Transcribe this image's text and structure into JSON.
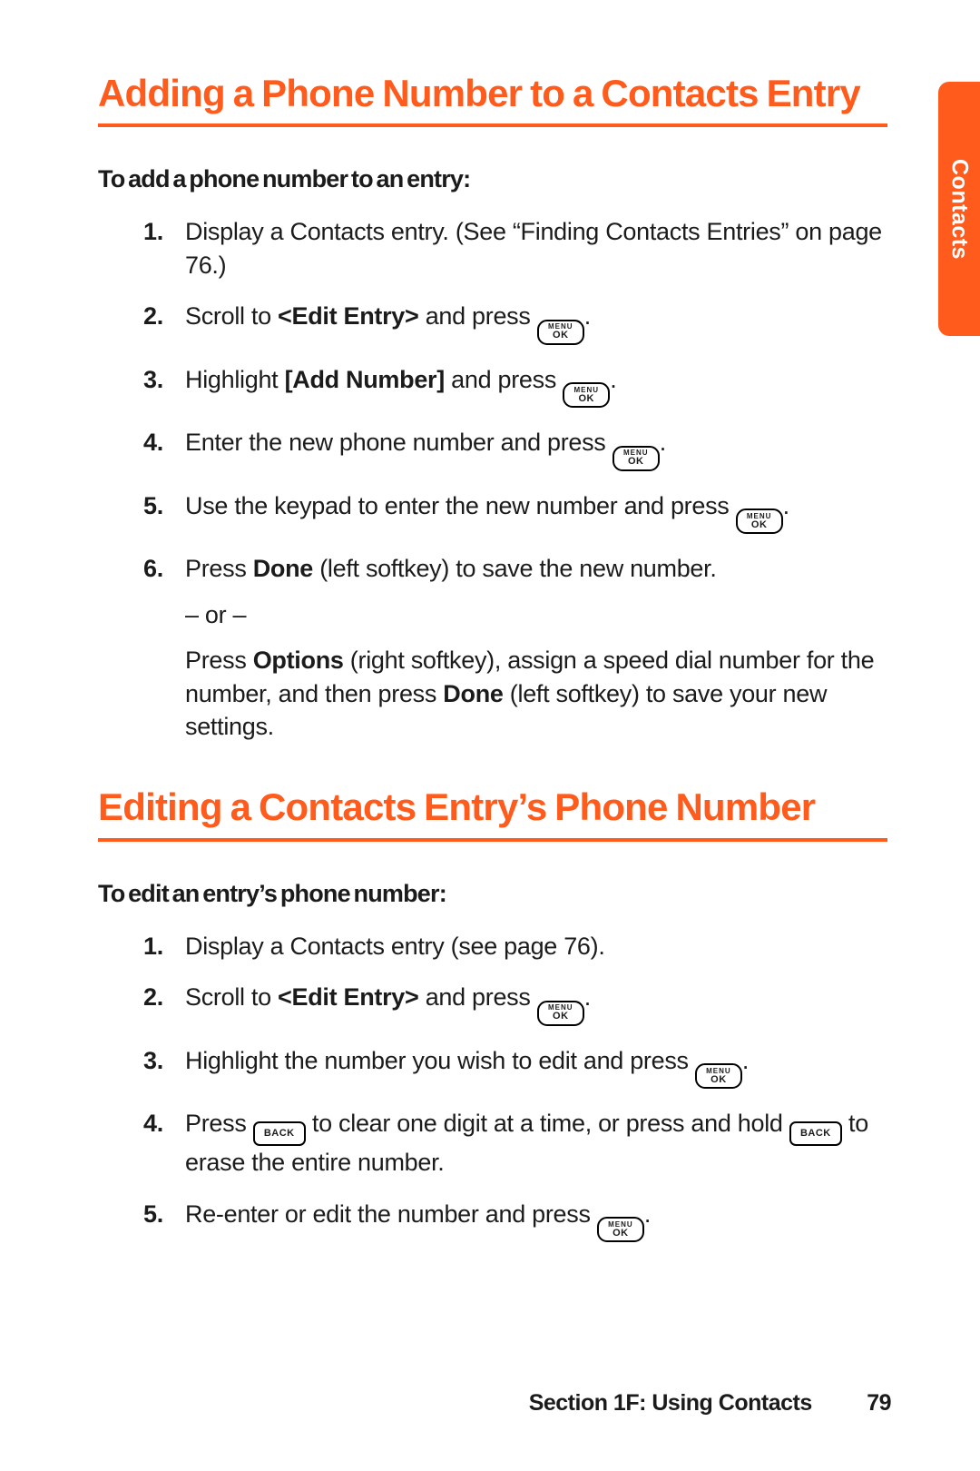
{
  "sideTab": "Contacts",
  "keys": {
    "ok_top": "MENU",
    "ok_bottom": "OK",
    "back": "BACK"
  },
  "section1": {
    "title": "Adding a Phone Number to a Contacts Entry",
    "subhead": "To add a phone number to an entry:",
    "steps": [
      {
        "n": "1.",
        "html": "Display a Contacts entry. (See “Finding Contacts Entries” on page 76.)"
      },
      {
        "n": "2.",
        "html": "Scroll to <b>&lt;Edit Entry&gt;</b> and press {OK}."
      },
      {
        "n": "3.",
        "html": "Highlight <b>[Add Number]</b> and press {OK}."
      },
      {
        "n": "4.",
        "html": "Enter the new phone number and press {OK}."
      },
      {
        "n": "5.",
        "html": "Use the keypad to enter the new number and press {OK}."
      },
      {
        "n": "6.",
        "html": "Press <b>Done</b> (left softkey) to save the new number.",
        "subs": [
          "– or –",
          "Press <b>Options</b> (right softkey), assign a speed dial number for the number, and then press <b>Done</b> (left softkey) to save your new settings."
        ]
      }
    ]
  },
  "section2": {
    "title": "Editing a Contacts Entry’s Phone Number",
    "subhead": "To edit an entry’s phone number:",
    "steps": [
      {
        "n": "1.",
        "html": "Display a Contacts entry (see page 76)."
      },
      {
        "n": "2.",
        "html": "Scroll to <b>&lt;Edit Entry&gt;</b> and press {OK}."
      },
      {
        "n": "3.",
        "html": "Highlight the number you wish to edit and press {OK}."
      },
      {
        "n": "4.",
        "html": "Press {BACK} to clear one digit at a time, or press and hold {BACK} to erase the entire number."
      },
      {
        "n": "5.",
        "html": "Re-enter or edit the number and press {OK}."
      }
    ]
  },
  "footer": {
    "section": "Section 1F: Using Contacts",
    "page": "79"
  }
}
